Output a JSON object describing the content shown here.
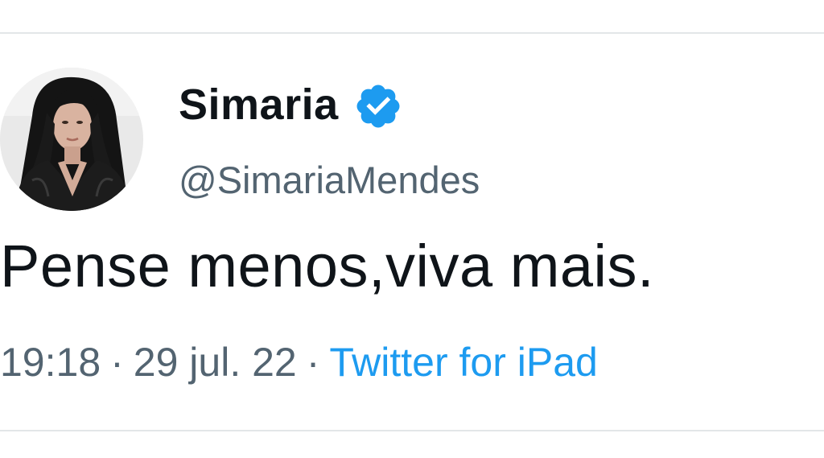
{
  "tweet": {
    "author": {
      "display_name": "Simaria",
      "handle": "@SimariaMendes",
      "verified_icon": "verified-badge-icon",
      "avatar": "profile-photo"
    },
    "text": "Pense menos,viva mais.",
    "time": "19:18",
    "date": "29 jul. 22",
    "separator": "·",
    "source": "Twitter for iPad"
  },
  "colors": {
    "text_primary": "#0f1419",
    "text_secondary": "#536471",
    "accent_blue": "#1d9bf0",
    "divider": "#e3e6e8"
  }
}
